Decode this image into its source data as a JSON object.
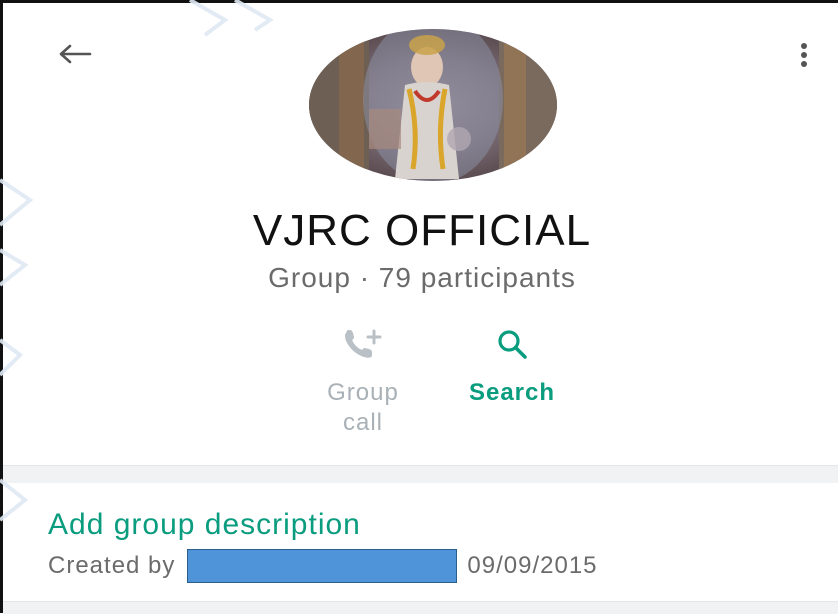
{
  "header": {
    "back_icon": "arrow-left-icon",
    "more_icon": "more-vertical-icon",
    "title": "VJRC OFFICIAL",
    "subtitle": "Group · 79 participants"
  },
  "actions": {
    "call": {
      "icon": "add-call-icon",
      "line1": "Group",
      "line2": "call",
      "color": "#a9b1b6"
    },
    "search": {
      "icon": "search-icon",
      "label": "Search",
      "color": "#0a9c7e"
    }
  },
  "description": {
    "add_label": "Add group description",
    "created_prefix": "Created by",
    "created_date": "09/09/2015"
  },
  "colors": {
    "accent": "#0a9c7e",
    "redaction": "#4f94d8",
    "separator": "#f0f2f3"
  }
}
